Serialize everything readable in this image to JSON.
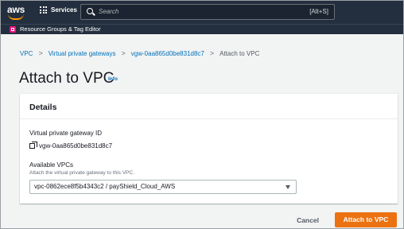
{
  "topnav": {
    "logo_text": "aws",
    "services_label": "Services",
    "search_placeholder": "Search",
    "search_shortcut": "[Alt+S]"
  },
  "resource_bar": {
    "label": "Resource Groups & Tag Editor"
  },
  "breadcrumb": {
    "items": [
      "VPC",
      "Virtual private gateways",
      "vgw-0aa865d0be831d8c7",
      "Attach to VPC"
    ],
    "separator": ">"
  },
  "page": {
    "title": "Attach to VPC",
    "info_label": "Info"
  },
  "details": {
    "heading": "Details",
    "gateway_id_label": "Virtual private gateway ID",
    "gateway_id_value": "vgw-0aa865d0be831d8c7",
    "available_vpcs_label": "Available VPCs",
    "available_vpcs_description": "Attach the virtual private gateway to this VPC.",
    "selected_vpc": "vpc-0862ece8f5b4343c2 / payShield_Cloud_AWS"
  },
  "actions": {
    "cancel_label": "Cancel",
    "submit_label": "Attach to VPC"
  },
  "colors": {
    "nav_bg": "#232f3e",
    "link": "#0073bb",
    "primary_button": "#ec7211",
    "aws_orange": "#ff9900",
    "resource_groups_icon": "#e7157b"
  }
}
